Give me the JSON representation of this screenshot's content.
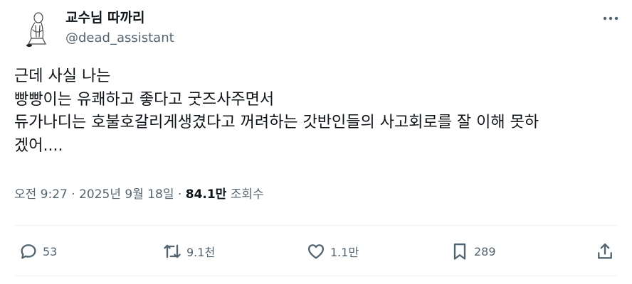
{
  "author": {
    "display_name": "교수님 따까리",
    "handle": "@dead_assistant"
  },
  "body": {
    "lines": [
      "근데 사실 나는",
      "빵빵이는 유쾌하고 좋다고 굿즈사주면서",
      "듀가나디는 호불호갈리게생겼다고 꺼려하는 갓반인들의 사고회로를 잘 이해 못하",
      "겠어...."
    ]
  },
  "meta": {
    "timestamp": "오전 9:27 · 2025년 9월 18일",
    "separator": " · ",
    "views_count": "84.1만",
    "views_label": "조회수"
  },
  "actions": {
    "replies": "53",
    "retweets": "9.1천",
    "likes": "1.1만",
    "bookmarks": "289"
  },
  "icons": {
    "more": "more-horizontal-icon",
    "reply": "reply-icon",
    "retweet": "retweet-icon",
    "like": "heart-icon",
    "bookmark": "bookmark-icon",
    "share": "share-icon"
  },
  "colors": {
    "text_primary": "#0f1419",
    "text_secondary": "#536471",
    "divider": "#eff3f4"
  }
}
